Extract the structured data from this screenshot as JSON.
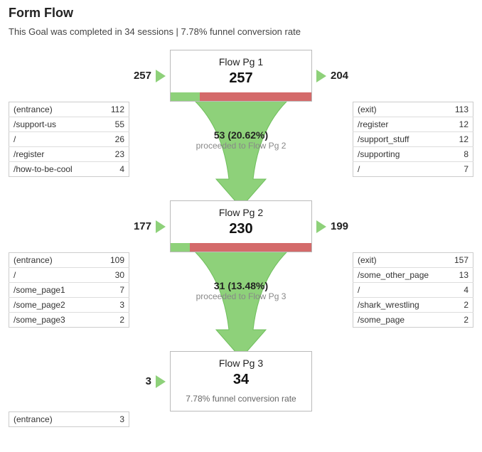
{
  "header": {
    "title": "Form Flow",
    "subtitle": "This Goal was completed in 34 sessions | 7.78% funnel conversion rate"
  },
  "steps": [
    {
      "name": "Flow Pg 1",
      "value": "257",
      "in_count": "257",
      "out_count": "204",
      "bar_green_pct": 20.62,
      "bar_red_pct": 79.38,
      "funnel": {
        "main": "53 (20.62%)",
        "sub": "proceeded to Flow Pg 2"
      },
      "in_table": [
        {
          "label": "(entrance)",
          "value": "112"
        },
        {
          "label": "/support-us",
          "value": "55"
        },
        {
          "label": "/",
          "value": "26"
        },
        {
          "label": "/register",
          "value": "23"
        },
        {
          "label": "/how-to-be-cool",
          "value": "4"
        }
      ],
      "out_table": [
        {
          "label": "(exit)",
          "value": "113"
        },
        {
          "label": "/register",
          "value": "12"
        },
        {
          "label": "/support_stuff",
          "value": "12"
        },
        {
          "label": "/supporting",
          "value": "8"
        },
        {
          "label": "/",
          "value": "7"
        }
      ]
    },
    {
      "name": "Flow Pg 2",
      "value": "230",
      "in_count": "177",
      "out_count": "199",
      "bar_green_pct": 13.48,
      "bar_red_pct": 86.52,
      "funnel": {
        "main": "31 (13.48%)",
        "sub": "proceeded to Flow Pg 3"
      },
      "in_table": [
        {
          "label": "(entrance)",
          "value": "109"
        },
        {
          "label": "/",
          "value": "30"
        },
        {
          "label": "/some_page1",
          "value": "7"
        },
        {
          "label": "/some_page2",
          "value": "3"
        },
        {
          "label": "/some_page3",
          "value": "2"
        }
      ],
      "out_table": [
        {
          "label": "(exit)",
          "value": "157"
        },
        {
          "label": "/some_other_page",
          "value": "13"
        },
        {
          "label": "/",
          "value": "4"
        },
        {
          "label": "/shark_wrestling",
          "value": "2"
        },
        {
          "label": "/some_page",
          "value": "2"
        }
      ]
    },
    {
      "name": "Flow Pg 3",
      "value": "34",
      "in_count": "3",
      "out_count": null,
      "subtext": "7.78% funnel conversion rate",
      "in_table": [
        {
          "label": "(entrance)",
          "value": "3"
        }
      ]
    }
  ]
}
